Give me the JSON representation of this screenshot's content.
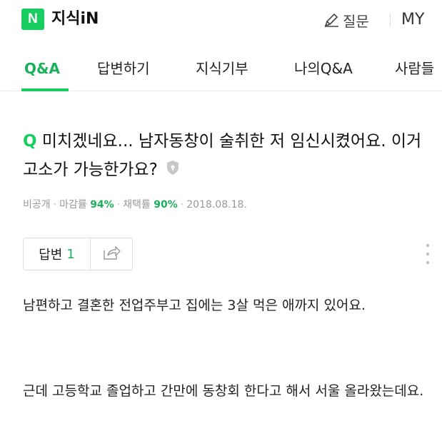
{
  "header": {
    "logo_letter": "N",
    "brand": "지식iN",
    "ask_label": "질문",
    "my_label": "MY"
  },
  "tabs": [
    {
      "label": "Q&A",
      "active": true
    },
    {
      "label": "답변하기"
    },
    {
      "label": "지식기부"
    },
    {
      "label": "나의Q&A"
    },
    {
      "label": "사람들"
    }
  ],
  "question": {
    "q_mark": "Q",
    "title": "미치겠네요... 남자동창이 술취한 저 임신시켰어요. 이거 고소가 가능한가요?",
    "meta": {
      "author": "비공개",
      "close_rate_label": "마감률",
      "close_rate": "94%",
      "adopt_rate_label": "채택률",
      "adopt_rate": "90%",
      "date": "2018.08.18."
    },
    "answer_button_label": "답변",
    "answer_count": "1"
  },
  "body": {
    "paragraph1": "남편하고 결혼한 전업주부고 집에는 3살 먹은 애까지 있어요.",
    "paragraph2": "근데 고등학교 졸업하고 간만에 동창회 한다고 해서 서울 올라왔는데요."
  },
  "colors": {
    "accent": "#19ce60",
    "accent_text": "#19b25a"
  }
}
